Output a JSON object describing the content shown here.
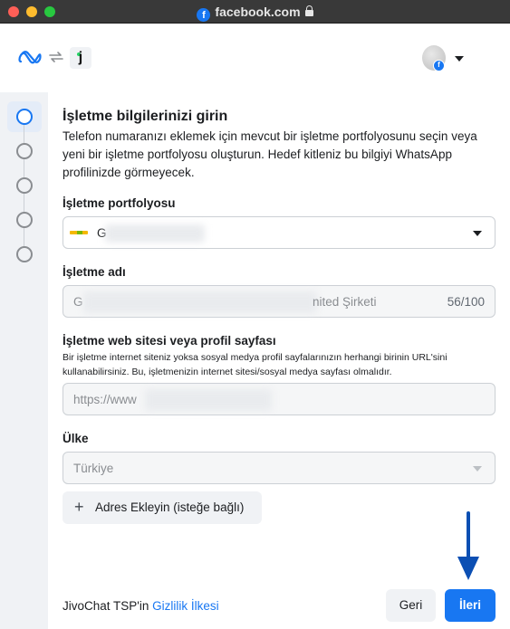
{
  "window": {
    "title": "facebook.com",
    "favicon_letter": "f"
  },
  "header": {
    "logo": "meta-logo",
    "sync": "sync-icon",
    "app_glyph": "j",
    "avatar_badge": "f"
  },
  "stepper": {
    "steps": [
      "active",
      "pending",
      "pending",
      "pending",
      "pending"
    ],
    "active_color": "#1877f2"
  },
  "form": {
    "heading": "İşletme bilgilerinizi girin",
    "description": "Telefon numaranızı eklemek için mevcut bir işletme portfolyosunu seçin veya yeni bir işletme portfolyosu oluşturun. Hedef kitleniz bu bilgiyi WhatsApp profilinizde görmeyecek.",
    "portfolio": {
      "label": "İşletme portfolyosu",
      "selected": "G"
    },
    "business_name": {
      "label": "İşletme adı",
      "value_start": "G",
      "value_end": "nited Şirketi",
      "counter": "56/100"
    },
    "website": {
      "label": "İşletme web sitesi veya profil sayfası",
      "help": "Bir işletme internet siteniz yoksa sosyal medya profil sayfalarınızın herhangi birinin URL'sini kullanabilirsiniz. Bu, işletmenizin internet sitesi/sosyal medya sayfası olmalıdır.",
      "value": "https://www"
    },
    "country": {
      "label": "Ülke",
      "value": "Türkiye"
    },
    "add_address": {
      "icon": "+",
      "label": "Adres Ekleyin (isteğe bağlı)"
    }
  },
  "footer": {
    "prefix": "JivoChat TSP'in ",
    "link": "Gizlilik İlkesi",
    "back": "Geri",
    "next": "İleri"
  },
  "colors": {
    "primary": "#1877f2",
    "annotation_arrow": "#0b4fb3"
  }
}
